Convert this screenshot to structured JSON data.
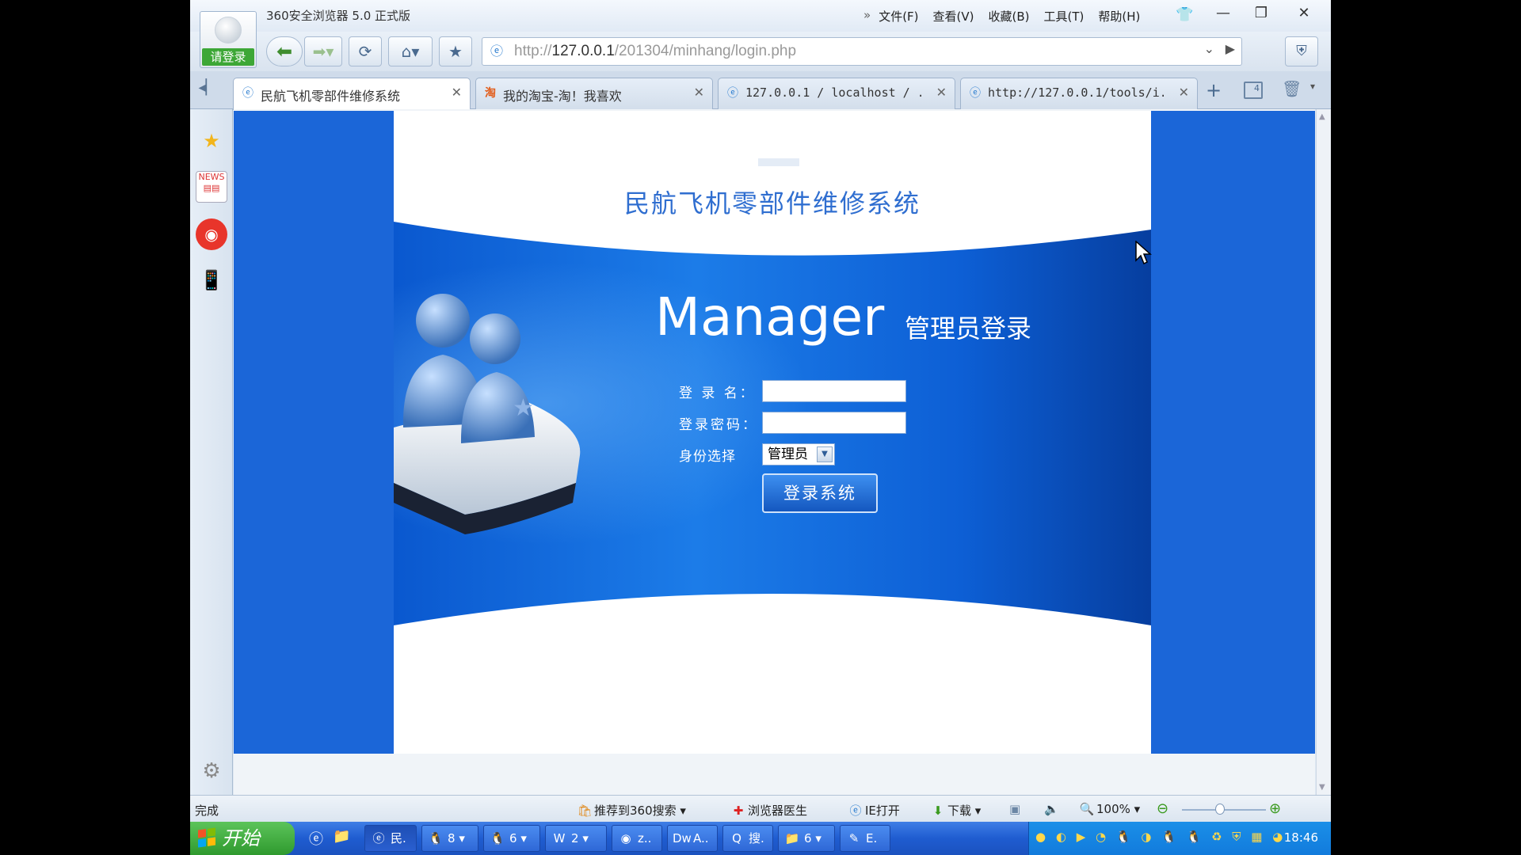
{
  "browser": {
    "app_title": "360安全浏览器 5.0 正式版",
    "login_badge": "请登录",
    "menu": [
      "文件(F)",
      "查看(V)",
      "收藏(B)",
      "工具(T)",
      "帮助(H)"
    ],
    "menu_chevron": "»",
    "url_scheme": "http://",
    "url_host": "127.0.0.1",
    "url_path": "/201304/minhang/login.php"
  },
  "tabs": [
    {
      "label": "民航飞机零部件维修系统",
      "icon": "ie-page-icon",
      "active": true
    },
    {
      "label": "我的淘宝-淘！我喜欢",
      "icon": "taobao-icon",
      "active": false
    },
    {
      "label": "127.0.0.1 / localhost / ...",
      "icon": "ie-page-icon",
      "active": false
    },
    {
      "label": "http://127.0.0.1/tools/i...",
      "icon": "ie-page-icon",
      "active": false
    }
  ],
  "tab_count": "4",
  "page": {
    "system_title": "民航飞机零部件维修系统",
    "manager_word": "Manager",
    "manager_cn": "管理员登录",
    "label_username": "登 录 名：",
    "label_password": "登录密码：",
    "label_role": "身份选择",
    "username_value": "",
    "password_value": "",
    "role_selected": "管理员",
    "login_button": "登录系统"
  },
  "status": {
    "text": "完成",
    "search": "推荐到360搜索",
    "doctor": "浏览器医生",
    "ie_open": "IE打开",
    "download": "下载",
    "zoom": "100%",
    "zoom_level": 0.45
  },
  "taskbar": {
    "start": "开始",
    "tasks": [
      "民.",
      "8",
      "6",
      "2",
      "z..",
      "A..",
      "搜.",
      "6",
      "E."
    ],
    "clock": "18:46"
  },
  "colors": {
    "page_blue": "#1b66d8",
    "title_blue": "#2f6ed0",
    "start_green": "#3da736"
  }
}
